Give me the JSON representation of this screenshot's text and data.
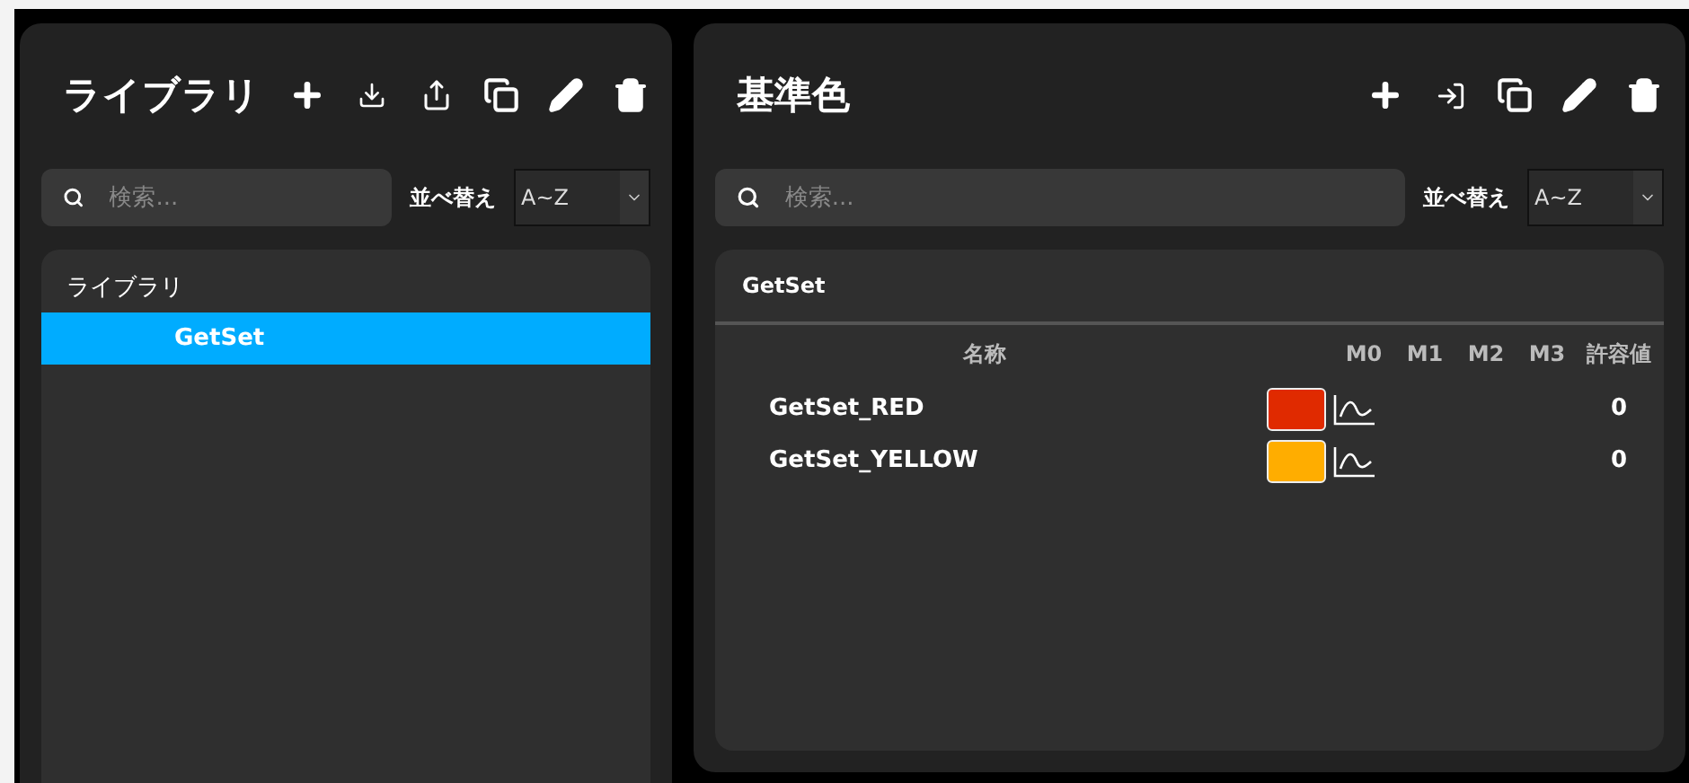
{
  "library": {
    "title": "ライブラリ",
    "search": {
      "placeholder": "検索..."
    },
    "sort": {
      "label": "並べ替え",
      "value": "A~Z"
    },
    "tree": [
      {
        "label": "ライブラリ",
        "selected": false,
        "children": [
          {
            "label": "GetSet",
            "selected": true
          }
        ]
      }
    ]
  },
  "colors": {
    "title": "基準色",
    "search": {
      "placeholder": "検索..."
    },
    "sort": {
      "label": "並べ替え",
      "value": "A~Z"
    },
    "group": "GetSet",
    "columns": [
      "名称",
      "M0",
      "M1",
      "M2",
      "M3",
      "許容値"
    ],
    "rows": [
      {
        "name": "GetSet_RED",
        "color": "#e02a00",
        "tolerance": "0"
      },
      {
        "name": "GetSet_YELLOW",
        "color": "#ffad00",
        "tolerance": "0"
      }
    ]
  }
}
